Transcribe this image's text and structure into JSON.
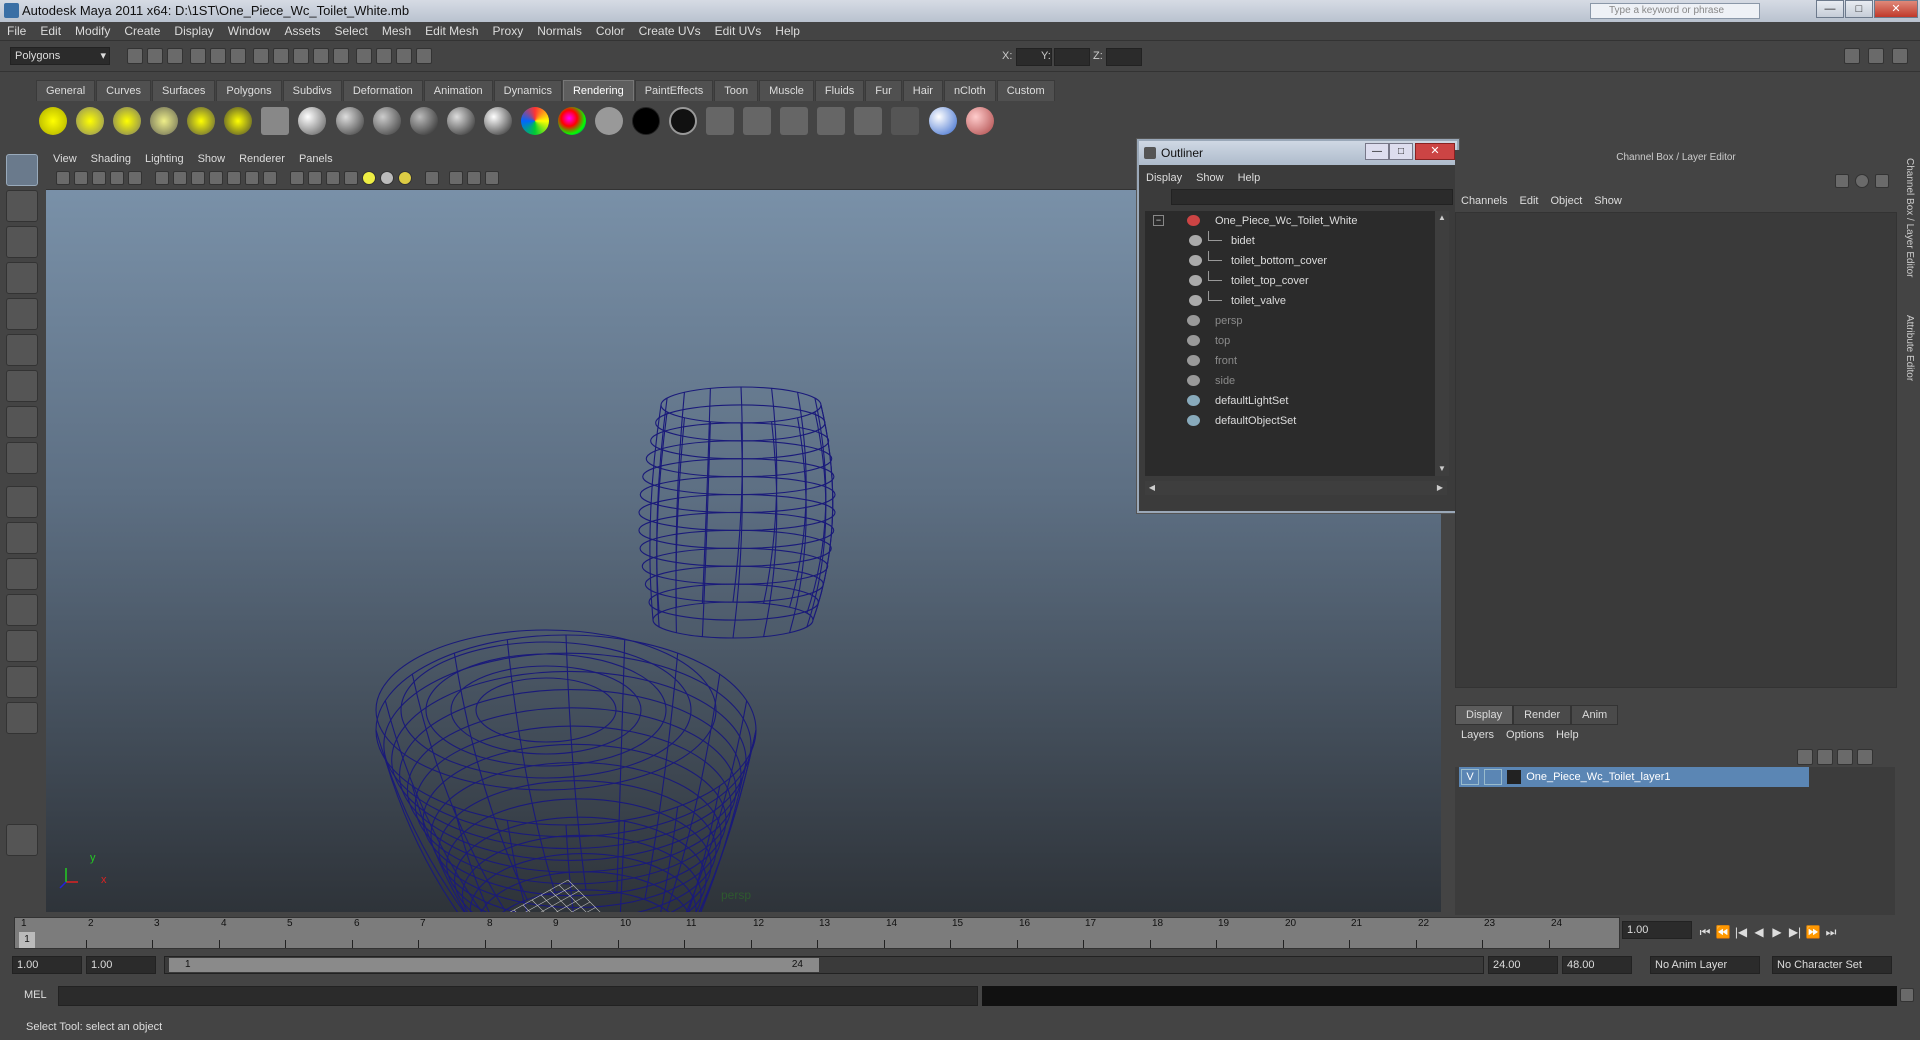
{
  "window": {
    "title": "Autodesk Maya 2011 x64: D:\\1ST\\One_Piece_Wc_Toilet_White.mb",
    "search_placeholder": "Type a keyword or phrase",
    "minimize": "—",
    "maximize": "□",
    "close": "✕"
  },
  "menubar": [
    "File",
    "Edit",
    "Modify",
    "Create",
    "Display",
    "Window",
    "Assets",
    "Select",
    "Mesh",
    "Edit Mesh",
    "Proxy",
    "Normals",
    "Color",
    "Create UVs",
    "Edit UVs",
    "Help"
  ],
  "statusline": {
    "mode": "Polygons",
    "x_label": "X:",
    "y_label": "Y:",
    "z_label": "Z:"
  },
  "shelf": {
    "tabs": [
      "General",
      "Curves",
      "Surfaces",
      "Polygons",
      "Subdivs",
      "Deformation",
      "Animation",
      "Dynamics",
      "Rendering",
      "PaintEffects",
      "Toon",
      "Muscle",
      "Fluids",
      "Fur",
      "Hair",
      "nCloth",
      "Custom"
    ],
    "active_tab": "Rendering"
  },
  "viewport": {
    "menu": [
      "View",
      "Shading",
      "Lighting",
      "Show",
      "Renderer",
      "Panels"
    ],
    "camera_label": "persp",
    "axis_x": "x",
    "axis_y": "y",
    "wire_color": "#1a1a7a"
  },
  "outliner": {
    "title": "Outliner",
    "menu": [
      "Display",
      "Show",
      "Help"
    ],
    "items": [
      {
        "label": "One_Piece_Wc_Toilet_White",
        "depth": 0,
        "dim": false,
        "expand": "−",
        "icon": "transform-icon"
      },
      {
        "label": "bidet",
        "depth": 1,
        "dim": false,
        "icon": "mesh-icon"
      },
      {
        "label": "toilet_bottom_cover",
        "depth": 1,
        "dim": false,
        "icon": "mesh-icon"
      },
      {
        "label": "toilet_top_cover",
        "depth": 1,
        "dim": false,
        "icon": "mesh-icon"
      },
      {
        "label": "toilet_valve",
        "depth": 1,
        "dim": false,
        "icon": "mesh-icon"
      },
      {
        "label": "persp",
        "depth": 0,
        "dim": true,
        "icon": "camera-icon"
      },
      {
        "label": "top",
        "depth": 0,
        "dim": true,
        "icon": "camera-icon"
      },
      {
        "label": "front",
        "depth": 0,
        "dim": true,
        "icon": "camera-icon"
      },
      {
        "label": "side",
        "depth": 0,
        "dim": true,
        "icon": "camera-icon"
      },
      {
        "label": "defaultLightSet",
        "depth": 0,
        "dim": false,
        "icon": "set-icon"
      },
      {
        "label": "defaultObjectSet",
        "depth": 0,
        "dim": false,
        "icon": "set-icon"
      }
    ]
  },
  "channelbox": {
    "title": "Channel Box / Layer Editor",
    "menu": [
      "Channels",
      "Edit",
      "Object",
      "Show"
    ]
  },
  "layers": {
    "tabs": [
      "Display",
      "Render",
      "Anim"
    ],
    "active_tab": "Display",
    "menu": [
      "Layers",
      "Options",
      "Help"
    ],
    "rows": [
      {
        "visible": "V",
        "name": "One_Piece_Wc_Toilet_layer1"
      }
    ]
  },
  "sidetabs": [
    "Channel Box / Layer Editor",
    "Attribute Editor"
  ],
  "timeslider": {
    "frames": [
      "1",
      "2",
      "3",
      "4",
      "5",
      "6",
      "7",
      "8",
      "9",
      "10",
      "11",
      "12",
      "13",
      "14",
      "15",
      "16",
      "17",
      "18",
      "19",
      "20",
      "21",
      "22",
      "23",
      "24"
    ],
    "current_frame": "1",
    "current_time": "1.00"
  },
  "rangeslider": {
    "start": "1.00",
    "anim_start": "1.00",
    "range_start": "1",
    "range_end": "24",
    "anim_end": "24.00",
    "end": "48.00",
    "anim_layer": "No Anim Layer",
    "char_set": "No Character Set"
  },
  "cmdline": {
    "label": "MEL"
  },
  "helpline": {
    "text": "Select Tool: select an object"
  }
}
